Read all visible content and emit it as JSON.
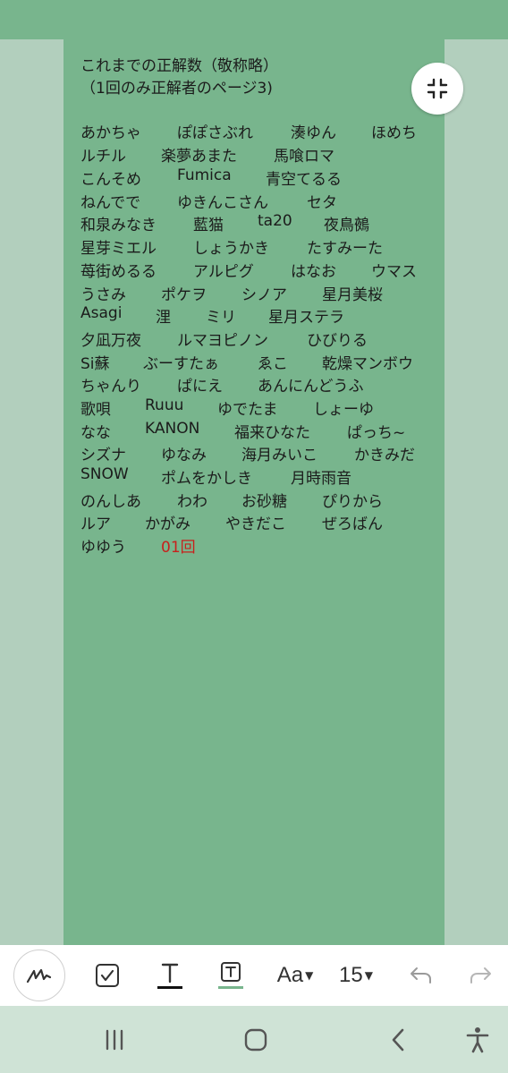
{
  "heading": {
    "line1": "これまでの正解数（敬称略）",
    "line2": "（1回のみ正解者のページ3)"
  },
  "names": [
    [
      "あかちゃ",
      "ぽぽさぶれ",
      "湊ゆん",
      "ほめち"
    ],
    [
      "ルチル",
      "楽夢あまた",
      "馬喰ロマ"
    ],
    [
      "こんそめ",
      "Fumica",
      "青空てるる"
    ],
    [
      "ねんでで",
      "ゆきんこさん",
      "セタ"
    ],
    [
      "和泉みなき",
      "藍猫",
      "ta20",
      "夜鳥鵺"
    ],
    [
      "星芽ミエル",
      "しょうかき",
      "たすみーた"
    ],
    [
      "苺街めるる",
      "アルピグ",
      "はなお",
      "ウマス"
    ],
    [
      "うさみ",
      "ポケヲ",
      "シノア",
      "星月美桜"
    ],
    [
      "Asagi",
      "浬",
      "ミリ",
      "星月ステラ"
    ],
    [
      "夕凪万夜",
      "ルマヨピノン",
      "ひびりる"
    ],
    [
      "Si蘇",
      "ぶーすたぁ",
      "ゑこ",
      "乾燥マンボウ"
    ],
    [
      "ちゃんり",
      "ぱにえ",
      "あんにんどうふ"
    ],
    [
      "歌唄",
      "Ruuu",
      "ゆでたま",
      "しょーゆ"
    ],
    [
      "なな",
      "KANON",
      "福来ひなた",
      "ぱっち~"
    ],
    [
      "シズナ",
      "ゆなみ",
      "海月みいこ",
      "かきみだ"
    ],
    [
      "SNOW",
      "ポムをかしき",
      "月時雨音"
    ],
    [
      "のんしあ",
      "わわ",
      "お砂糖",
      "ぴりから"
    ],
    [
      "ルア",
      "かがみ",
      "やきだこ",
      "ぜろばん"
    ],
    [
      "ゆゆう",
      "01回"
    ]
  ],
  "count_color": "#c8201c",
  "toolbar": {
    "font_label": "Aa",
    "font_size": "15",
    "icons": [
      "pen-icon",
      "checkbox-icon",
      "text-style-icon",
      "text-box-icon",
      "undo-icon",
      "redo-icon"
    ]
  },
  "colors": {
    "page_bg": "#78b58d",
    "margin_bg": "#b2cfbd",
    "navbar_bg": "#cfe3d6"
  },
  "navbar": {
    "icons": [
      "recent-apps-icon",
      "home-icon",
      "back-icon",
      "accessibility-icon"
    ]
  }
}
